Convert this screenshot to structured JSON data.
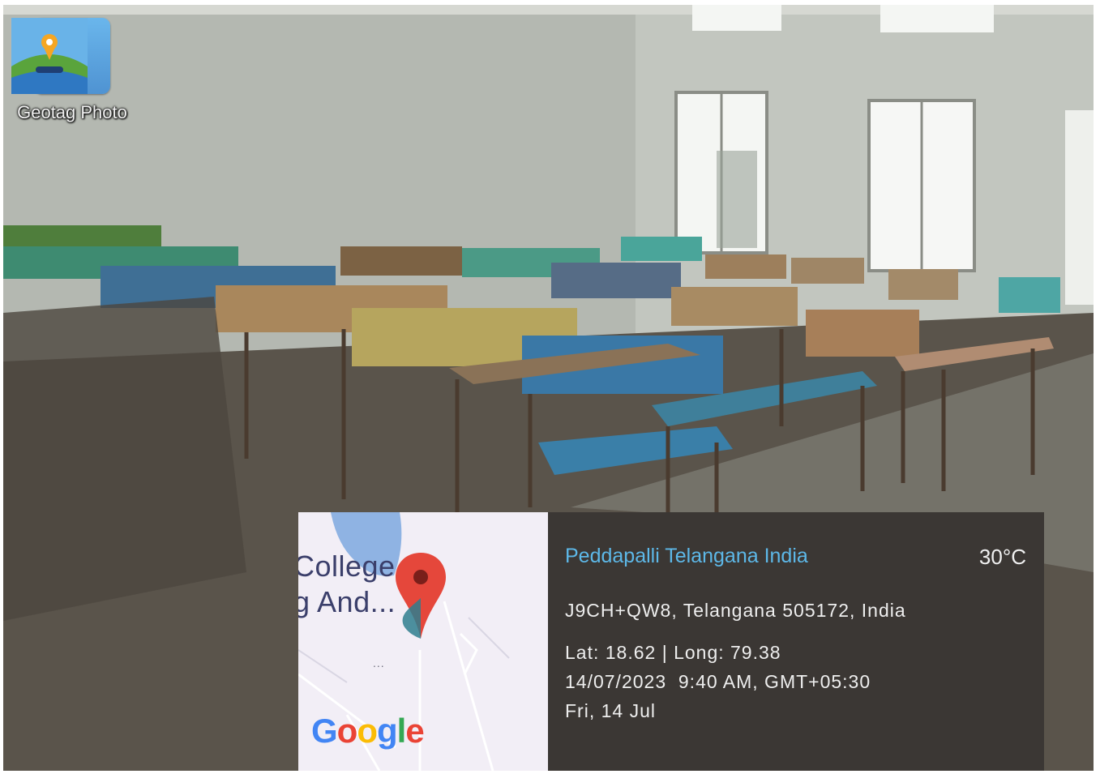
{
  "badge": {
    "app_name": "Geotag Photo",
    "icon": "geotag-map-pin-icon"
  },
  "map": {
    "label_line1": "College",
    "label_line2": "g And...",
    "dots": "...",
    "provider_logo": "Google",
    "pin_icon": "map-pin-icon",
    "logo_colors": [
      "#4285F4",
      "#EA4335",
      "#FBBC05",
      "#4285F4",
      "#34A853",
      "#EA4335"
    ]
  },
  "info": {
    "place": "Peddapalli Telangana India",
    "temperature": "30°C",
    "address": "J9CH+QW8, Telangana 505172, India",
    "coordinates": "Lat: 18.62 | Long: 79.38",
    "datetime": "14/07/2023  9:40 AM, GMT+05:30",
    "day": "Fri, 14 Jul"
  },
  "colors": {
    "place_text": "#5db8e8",
    "info_background": "#3b3734",
    "map_pin": "#e5473b"
  }
}
